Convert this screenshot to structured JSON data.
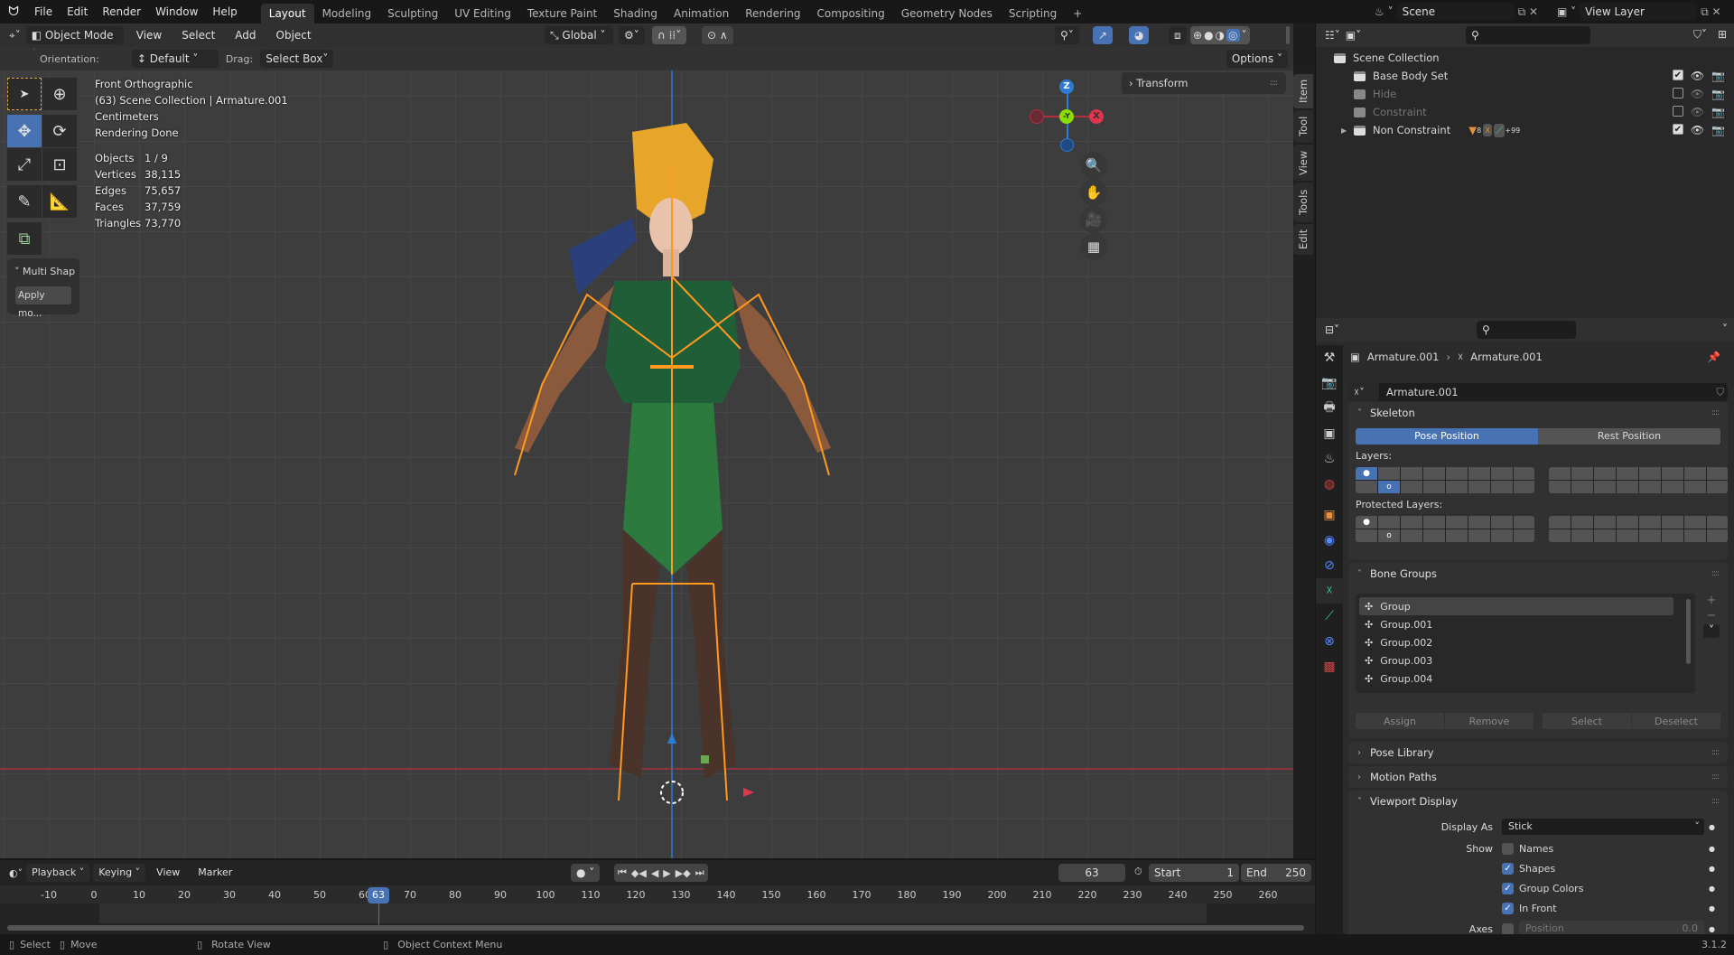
{
  "topbar": {
    "menus": [
      "File",
      "Edit",
      "Render",
      "Window",
      "Help"
    ],
    "workspaces": [
      "Layout",
      "Modeling",
      "Sculpting",
      "UV Editing",
      "Texture Paint",
      "Shading",
      "Animation",
      "Rendering",
      "Compositing",
      "Geometry Nodes",
      "Scripting"
    ],
    "active_workspace": "Layout",
    "scene": "Scene",
    "view_layer": "View Layer"
  },
  "viewport_header": {
    "mode": "Object Mode",
    "menus": [
      "View",
      "Select",
      "Add",
      "Object"
    ],
    "transform_orientation": "Global",
    "options": "Options"
  },
  "tool_settings": {
    "orientation_label": "Orientation:",
    "orientation_value": "Default",
    "drag_label": "Drag:",
    "drag_value": "Select Box"
  },
  "overlay": {
    "view_name": "Front Orthographic",
    "context": "(63) Scene Collection | Armature.001",
    "units": "Centimeters",
    "render_status": "Rendering Done",
    "stats": [
      {
        "label": "Objects",
        "value": "1 / 9"
      },
      {
        "label": "Vertices",
        "value": "38,115"
      },
      {
        "label": "Edges",
        "value": "75,657"
      },
      {
        "label": "Faces",
        "value": "37,759"
      },
      {
        "label": "Triangles",
        "value": "73,770"
      }
    ]
  },
  "last_op": {
    "title": "Multi Shap",
    "button": "Apply mo..."
  },
  "gizmo": {
    "z": "Z",
    "y": "-Y",
    "x": "X"
  },
  "npanel": {
    "transform": "Transform",
    "tabs": [
      "Item",
      "Tool",
      "View",
      "Tools",
      "Edit"
    ]
  },
  "outliner": {
    "root": "Scene Collection",
    "rows": [
      {
        "name": "Base Body Set",
        "checked": true,
        "dim": false
      },
      {
        "name": "Hide",
        "checked": false,
        "dim": true
      },
      {
        "name": "Constraint",
        "checked": false,
        "dim": true
      },
      {
        "name": "Non Constraint",
        "checked": true,
        "dim": false,
        "badge_mesh": "8",
        "badge_more": "+99"
      }
    ]
  },
  "properties": {
    "breadcrumb": [
      "Armature.001",
      "Armature.001"
    ],
    "data_name": "Armature.001",
    "skeleton": {
      "title": "Skeleton",
      "pose": "Pose Position",
      "rest": "Rest Position",
      "layers_label": "Layers:",
      "protected_label": "Protected Layers:",
      "active_layers": [
        1,
        18
      ],
      "bone_layers": [
        1,
        18
      ]
    },
    "bone_groups": {
      "title": "Bone Groups",
      "items": [
        "Group",
        "Group.001",
        "Group.002",
        "Group.003",
        "Group.004"
      ],
      "selected": 0,
      "buttons": [
        "Assign",
        "Remove",
        "Select",
        "Deselect"
      ]
    },
    "collapsed_panels": [
      "Pose Library",
      "Motion Paths"
    ],
    "viewport_display": {
      "title": "Viewport Display",
      "display_as_label": "Display As",
      "display_as": "Stick",
      "show_label": "Show",
      "show": [
        {
          "label": "Names",
          "on": false
        },
        {
          "label": "Shapes",
          "on": true
        },
        {
          "label": "Group Colors",
          "on": true
        },
        {
          "label": "In Front",
          "on": true
        }
      ],
      "axes_label": "Axes",
      "axes_position_label": "Position",
      "axes_position": "0.0"
    }
  },
  "timeline": {
    "menus": [
      "Playback",
      "Keying",
      "View",
      "Marker"
    ],
    "current_frame": "63",
    "start_label": "Start",
    "start": "1",
    "end_label": "End",
    "end": "250",
    "ticks": [
      -10,
      0,
      10,
      20,
      30,
      40,
      50,
      60,
      70,
      80,
      90,
      100,
      110,
      120,
      130,
      140,
      150,
      160,
      170,
      180,
      190,
      200,
      210,
      220,
      230,
      240,
      250,
      260
    ],
    "frame_value": 63
  },
  "statusbar": {
    "items": [
      "Select",
      "Move",
      "Rotate View",
      "Object Context Menu"
    ],
    "version": "3.1.2"
  },
  "colors": {
    "accent": "#4772b3",
    "armature": "#ff9a1f",
    "x_axis": "#e0364b",
    "y_axis": "#8bdc00",
    "z_axis": "#2e7bd6"
  }
}
